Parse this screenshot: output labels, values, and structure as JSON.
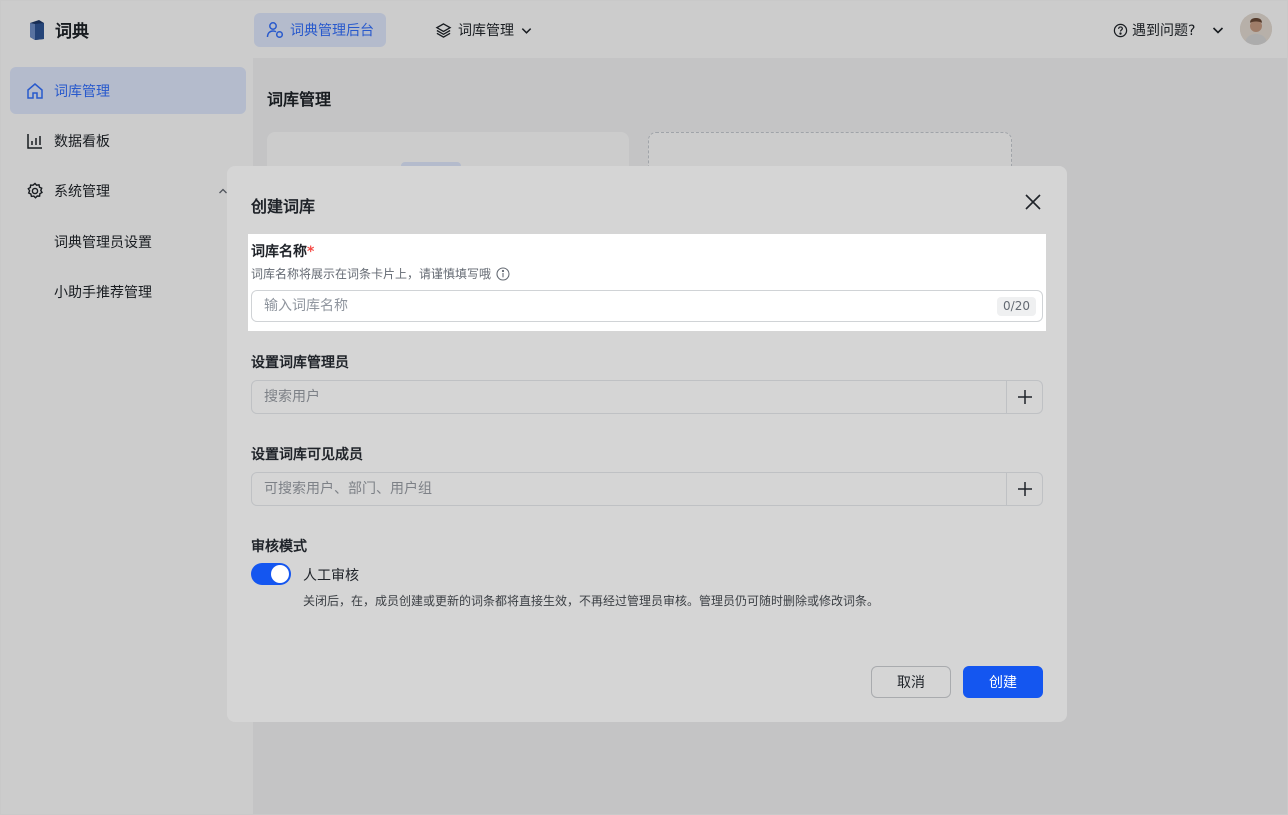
{
  "brand": {
    "name": "词典",
    "logo_icon": "dictionary-logo-icon"
  },
  "topbar": {
    "active_tab": {
      "label": "词典管理后台",
      "icon": "admin-user-icon"
    },
    "menu": {
      "label": "词库管理",
      "icon": "layers-icon"
    },
    "help": {
      "label": "遇到问题?",
      "icon": "question-circle-icon"
    }
  },
  "sidebar": {
    "items": [
      {
        "label": "词库管理",
        "icon": "home-icon",
        "active": true
      },
      {
        "label": "数据看板",
        "icon": "bar-chart-icon",
        "active": false
      },
      {
        "label": "系统管理",
        "icon": "gear-icon",
        "active": false
      }
    ],
    "subitems": [
      {
        "label": "词典管理员设置"
      },
      {
        "label": "小助手推荐管理"
      }
    ]
  },
  "main": {
    "title": "词库管理"
  },
  "modal": {
    "title": "创建词库",
    "name_field": {
      "label": "词库名称",
      "required_mark": "*",
      "hint": "词库名称将展示在词条卡片上，请谨慎填写哦",
      "placeholder": "输入词库名称",
      "value": "",
      "counter": "0/20"
    },
    "admin_field": {
      "label": "设置词库管理员",
      "placeholder": "搜索用户"
    },
    "members_field": {
      "label": "设置词库可见成员",
      "placeholder": "可搜索用户、部门、用户组"
    },
    "review": {
      "label": "审核模式",
      "toggle_label": "人工审核",
      "toggle_on": true,
      "description": "关闭后，在，成员创建或更新的词条都将直接生效，不再经过管理员审核。管理员仍可随时删除或修改词条。"
    },
    "buttons": {
      "cancel": "取消",
      "create": "创建"
    }
  },
  "colors": {
    "primary": "#1456f0",
    "accent_light": "#e1eaff",
    "required": "#f54a45"
  }
}
